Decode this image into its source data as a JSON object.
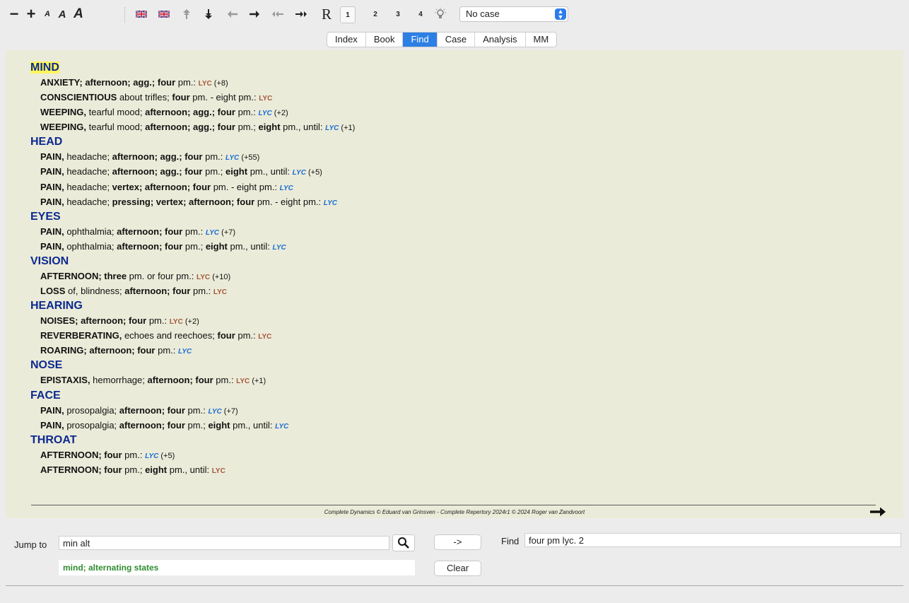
{
  "toolbar": {
    "minus_label": "−",
    "plus_label": "+",
    "font_small": "A",
    "font_medium": "A",
    "font_large": "A",
    "r_label": "R",
    "level1": "1",
    "level2": "2",
    "level3": "3",
    "level4": "4",
    "case_select": "No case"
  },
  "tabs": [
    {
      "label": "Index",
      "active": false
    },
    {
      "label": "Book",
      "active": false
    },
    {
      "label": "Find",
      "active": true
    },
    {
      "label": "Case",
      "active": false
    },
    {
      "label": "Analysis",
      "active": false
    },
    {
      "label": "MM",
      "active": false
    }
  ],
  "results": {
    "mind": {
      "title": "MIND",
      "r1": {
        "b1": "ANXIETY; afternoon; agg.; four",
        "t1": " pm.: ",
        "rem": "LYC",
        "cnt": " (+8)"
      },
      "r2": {
        "b1": "CONSCIENTIOUS",
        "t1": " about trifles; ",
        "b2": "four",
        "t2": " pm. - eight pm.: ",
        "rem": "LYC"
      },
      "r3": {
        "b1": "WEEPING,",
        "t1": " tearful mood; ",
        "b2": "afternoon; agg.; four",
        "t2": " pm.: ",
        "rem": "LYC",
        "cnt": " (+2)"
      },
      "r4": {
        "b1": "WEEPING,",
        "t1": " tearful mood; ",
        "b2": "afternoon; agg.; four",
        "t2": " pm.; ",
        "b3": "eight",
        "t3": " pm., until: ",
        "rem": "LYC",
        "cnt": " (+1)"
      }
    },
    "head": {
      "title": "HEAD",
      "r1": {
        "b1": "PAIN,",
        "t1": " headache; ",
        "b2": "afternoon; agg.; four",
        "t2": " pm.: ",
        "rem": "LYC",
        "cnt": " (+55)"
      },
      "r2": {
        "b1": "PAIN,",
        "t1": " headache; ",
        "b2": "afternoon; agg.; four",
        "t2": " pm.; ",
        "b3": "eight",
        "t3": " pm., until: ",
        "rem": "LYC",
        "cnt": " (+5)"
      },
      "r3": {
        "b1": "PAIN,",
        "t1": " headache; ",
        "b2": "vertex; afternoon; four",
        "t2": " pm. - eight pm.: ",
        "rem": "LYC"
      },
      "r4": {
        "b1": "PAIN,",
        "t1": " headache; ",
        "b2": "pressing; vertex; afternoon; four",
        "t2": " pm. - eight pm.: ",
        "rem": "LYC"
      }
    },
    "eyes": {
      "title": "EYES",
      "r1": {
        "b1": "PAIN,",
        "t1": " ophthalmia; ",
        "b2": "afternoon; four",
        "t2": " pm.: ",
        "rem": "LYC",
        "cnt": " (+7)"
      },
      "r2": {
        "b1": "PAIN,",
        "t1": " ophthalmia; ",
        "b2": "afternoon; four",
        "t2": " pm.; ",
        "b3": "eight",
        "t3": " pm., until: ",
        "rem": "LYC"
      }
    },
    "vision": {
      "title": "VISION",
      "r1": {
        "b1": "AFTERNOON; three",
        "t1": " pm. or four pm.: ",
        "rem": "LYC",
        "cnt": " (+10)"
      },
      "r2": {
        "b1": "LOSS",
        "t1": " of, blindness; ",
        "b2": "afternoon; four",
        "t2": " pm.: ",
        "rem": "LYC"
      }
    },
    "hearing": {
      "title": "HEARING",
      "r1": {
        "b1": "NOISES; afternoon; four",
        "t1": " pm.: ",
        "rem": "LYC",
        "cnt": " (+2)"
      },
      "r2": {
        "b1": "REVERBERATING,",
        "t1": " echoes and reechoes; ",
        "b2": "four",
        "t2": " pm.: ",
        "rem": "LYC"
      },
      "r3": {
        "b1": "ROARING; afternoon; four",
        "t1": " pm.: ",
        "rem": "LYC"
      }
    },
    "nose": {
      "title": "NOSE",
      "r1": {
        "b1": "EPISTAXIS,",
        "t1": " hemorrhage; ",
        "b2": "afternoon; four",
        "t2": " pm.: ",
        "rem": "LYC",
        "cnt": " (+1)"
      }
    },
    "face": {
      "title": "FACE",
      "r1": {
        "b1": "PAIN,",
        "t1": " prosopalgia; ",
        "b2": "afternoon; four",
        "t2": " pm.: ",
        "rem": "LYC",
        "cnt": " (+7)"
      },
      "r2": {
        "b1": "PAIN,",
        "t1": " prosopalgia; ",
        "b2": "afternoon; four",
        "t2": " pm.; ",
        "b3": "eight",
        "t3": " pm., until: ",
        "rem": "LYC"
      }
    },
    "throat": {
      "title": "THROAT",
      "r1": {
        "b1": "AFTERNOON; four",
        "t1": " pm.: ",
        "rem": "LYC",
        "cnt": " (+5)"
      },
      "r2": {
        "b1": "AFTERNOON; four",
        "t1": " pm.; ",
        "b2": "eight",
        "t2": " pm., until: ",
        "rem": "LYC"
      }
    }
  },
  "footer": {
    "copyright": "Complete Dynamics © Eduard van Grinsven  -  Complete Repertory 2024r1 © 2024 Roger van Zandvoort"
  },
  "bottom": {
    "jump_label": "Jump to",
    "jump_value": "min alt",
    "go_button": "->",
    "find_label": "Find",
    "find_value": "four pm lyc. 2",
    "suggestion": "mind; alternating states",
    "clear_button": "Clear"
  },
  "colors": {
    "content_bg": "#ebebd9",
    "section_title": "#0c2a90",
    "remedy_brown": "#a5573a",
    "remedy_blue": "#1a6fd3",
    "active_tab": "#2c7fe5",
    "suggestion_green": "#2f8c2f",
    "highlight": "#fdf65c"
  },
  "icons": [
    "minus-icon",
    "plus-icon",
    "flag-uk-icon",
    "flag-uk-alt-icon",
    "arrow-up-top-icon",
    "arrow-down-bottom-icon",
    "arrow-left-icon",
    "arrow-right-icon",
    "double-arrow-left-icon",
    "double-arrow-right-icon",
    "lightbulb-icon",
    "search-icon",
    "next-page-arrow-icon"
  ]
}
